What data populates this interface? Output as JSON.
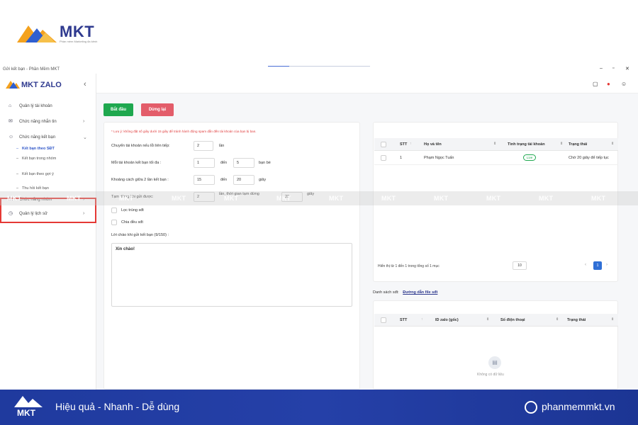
{
  "brand": {
    "name": "MKT",
    "tagline": "Phần mềm Marketing đa kênh"
  },
  "window": {
    "title": "Gửi kết bạn - Phần Mềm MKT",
    "controls": [
      "–",
      "▫",
      "✕"
    ]
  },
  "sidebar": {
    "logo_text": "MKT ZALO",
    "collapse": "‹",
    "items": [
      {
        "label": "Quản lý tài khoản",
        "icon": "⌂"
      },
      {
        "label": "Chức năng nhắn tin",
        "icon": "✉",
        "chev": "›"
      },
      {
        "label": "Chức năng kết bạn",
        "icon": "☺",
        "chev": "⌄"
      },
      {
        "label": "Chức năng nhóm",
        "icon": "☷",
        "chev": "›"
      },
      {
        "label": "Quản lý lịch sử",
        "icon": "◷",
        "chev": "›"
      }
    ],
    "subitems": [
      {
        "label": "Kết bạn theo SĐT",
        "dash": "–"
      },
      {
        "label": "Kết bạn trong nhóm",
        "dash": "–"
      },
      {
        "label": "Kết bạn theo gợi ý",
        "dash": "–"
      },
      {
        "label": "Thu hồi kết bạn",
        "dash": "–"
      }
    ]
  },
  "toolbar": {
    "start_label": "Bắt đầu",
    "stop_label": "Dừng lại"
  },
  "settings": {
    "note": "* Lưu ý: không đặt số giây dưới 15 giây để tránh hành động spam dẫn đến tài khoản của bạn bị ban.",
    "switch_label": "Chuyển tài khoản nếu lỗi liên tiếp:",
    "switch_value": "2",
    "switch_unit": "lần",
    "max_label": "Mỗi tài khoản kết bạn tối đa :",
    "max_from": "1",
    "max_to_label": "đến",
    "max_to": "5",
    "max_unit": "bạn bè",
    "gap_label": "Khoảng cách giữa 2 lần kết bạn :",
    "gap_from": "15",
    "gap_to_label": "đến",
    "gap_to": "20",
    "gap_unit": "giây",
    "pause_label": "Tạm dừng khi gửi được:",
    "pause_count": "2",
    "pause_mid": "lần, thời gian tạm dừng",
    "pause_time": "20",
    "pause_unit": "giây",
    "filter_label": "Lọc trùng sđt",
    "split_label": "Chia đều sđt",
    "greeting_label": "Lời chào khi gửi kết bạn (9/150) :",
    "greeting_value": "Xin chào!"
  },
  "accounts_table": {
    "headers": [
      "STT",
      "Họ và tên",
      "Tình trạng tài khoản",
      "Trạng thái"
    ],
    "sort_icons": [
      "↑",
      "⇕",
      "⇕",
      "⇕"
    ],
    "rows": [
      {
        "stt": "1",
        "name": "Phạm Ngọc Tuấn",
        "status": "Live",
        "state": "Chờ 20 giây để tiếp tục"
      }
    ],
    "pager_text": "Hiển thị từ 1 đến 1 trong tổng số 1 mục",
    "page_size": "10",
    "prev": "‹",
    "page": "1",
    "next": "›"
  },
  "phone_list": {
    "label": "Danh sách sđt:",
    "link": "Đường dẫn file sđt",
    "headers": [
      "STT",
      "ID zalo (gốc)",
      "Số điện thoại",
      "Trạng thái"
    ],
    "sort_icons": [
      "↑",
      "⇕",
      "⇕",
      "⇕"
    ],
    "empty_text": "Không có dữ liệu"
  },
  "watermark": "MKT",
  "banner": {
    "logo_name": "MKT",
    "slogan": "Hiệu quả - Nhanh  - Dễ dùng",
    "website": "phanmemmkt.vn"
  },
  "colors": {
    "brand_blue": "#2f3a8f",
    "start_green": "#1fa84f",
    "stop_red": "#e35d6a",
    "highlight_red": "#e53935",
    "banner_blue": "#2540a8"
  }
}
